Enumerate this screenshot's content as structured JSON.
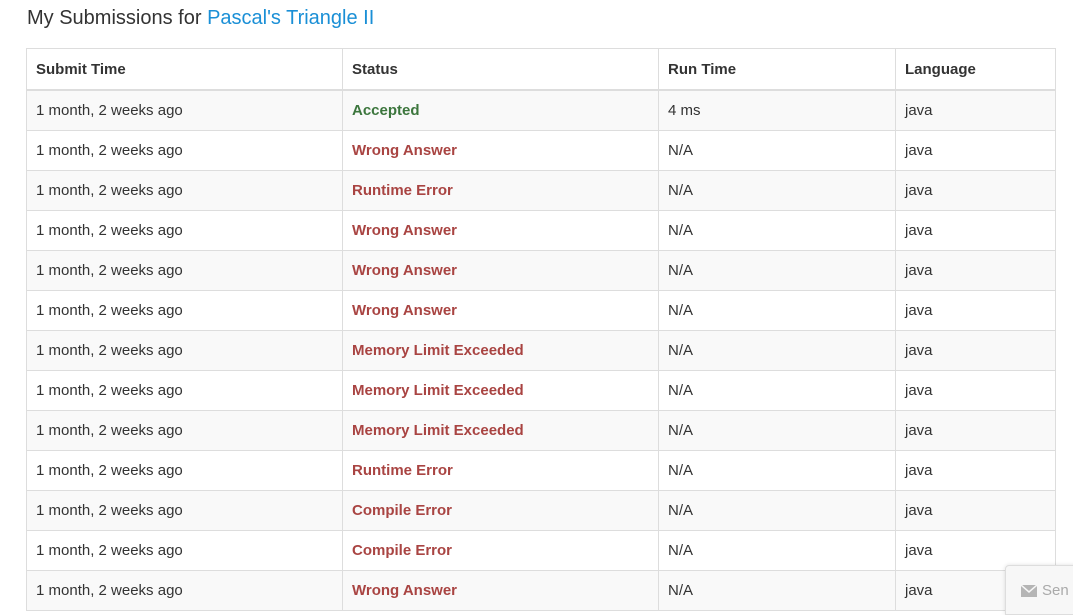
{
  "header": {
    "title_prefix": "My Submissions for",
    "problem_link": "Pascal's Triangle II"
  },
  "table": {
    "columns": [
      "Submit Time",
      "Status",
      "Run Time",
      "Language"
    ],
    "rows": [
      {
        "submit_time": "1 month, 2 weeks ago",
        "status": "Accepted",
        "run_time": "4 ms",
        "language": "java"
      },
      {
        "submit_time": "1 month, 2 weeks ago",
        "status": "Wrong Answer",
        "run_time": "N/A",
        "language": "java"
      },
      {
        "submit_time": "1 month, 2 weeks ago",
        "status": "Runtime Error",
        "run_time": "N/A",
        "language": "java"
      },
      {
        "submit_time": "1 month, 2 weeks ago",
        "status": "Wrong Answer",
        "run_time": "N/A",
        "language": "java"
      },
      {
        "submit_time": "1 month, 2 weeks ago",
        "status": "Wrong Answer",
        "run_time": "N/A",
        "language": "java"
      },
      {
        "submit_time": "1 month, 2 weeks ago",
        "status": "Wrong Answer",
        "run_time": "N/A",
        "language": "java"
      },
      {
        "submit_time": "1 month, 2 weeks ago",
        "status": "Memory Limit Exceeded",
        "run_time": "N/A",
        "language": "java"
      },
      {
        "submit_time": "1 month, 2 weeks ago",
        "status": "Memory Limit Exceeded",
        "run_time": "N/A",
        "language": "java"
      },
      {
        "submit_time": "1 month, 2 weeks ago",
        "status": "Memory Limit Exceeded",
        "run_time": "N/A",
        "language": "java"
      },
      {
        "submit_time": "1 month, 2 weeks ago",
        "status": "Runtime Error",
        "run_time": "N/A",
        "language": "java"
      },
      {
        "submit_time": "1 month, 2 weeks ago",
        "status": "Compile Error",
        "run_time": "N/A",
        "language": "java"
      },
      {
        "submit_time": "1 month, 2 weeks ago",
        "status": "Compile Error",
        "run_time": "N/A",
        "language": "java"
      },
      {
        "submit_time": "1 month, 2 weeks ago",
        "status": "Wrong Answer",
        "run_time": "N/A",
        "language": "java"
      }
    ]
  },
  "feedback": {
    "label": "Sen",
    "icon": "mail-icon"
  },
  "colors": {
    "link": "#1a8fd6",
    "accepted": "#3c763d",
    "error": "#a94442",
    "border": "#dddddd",
    "stripe": "#f9f9f9"
  }
}
